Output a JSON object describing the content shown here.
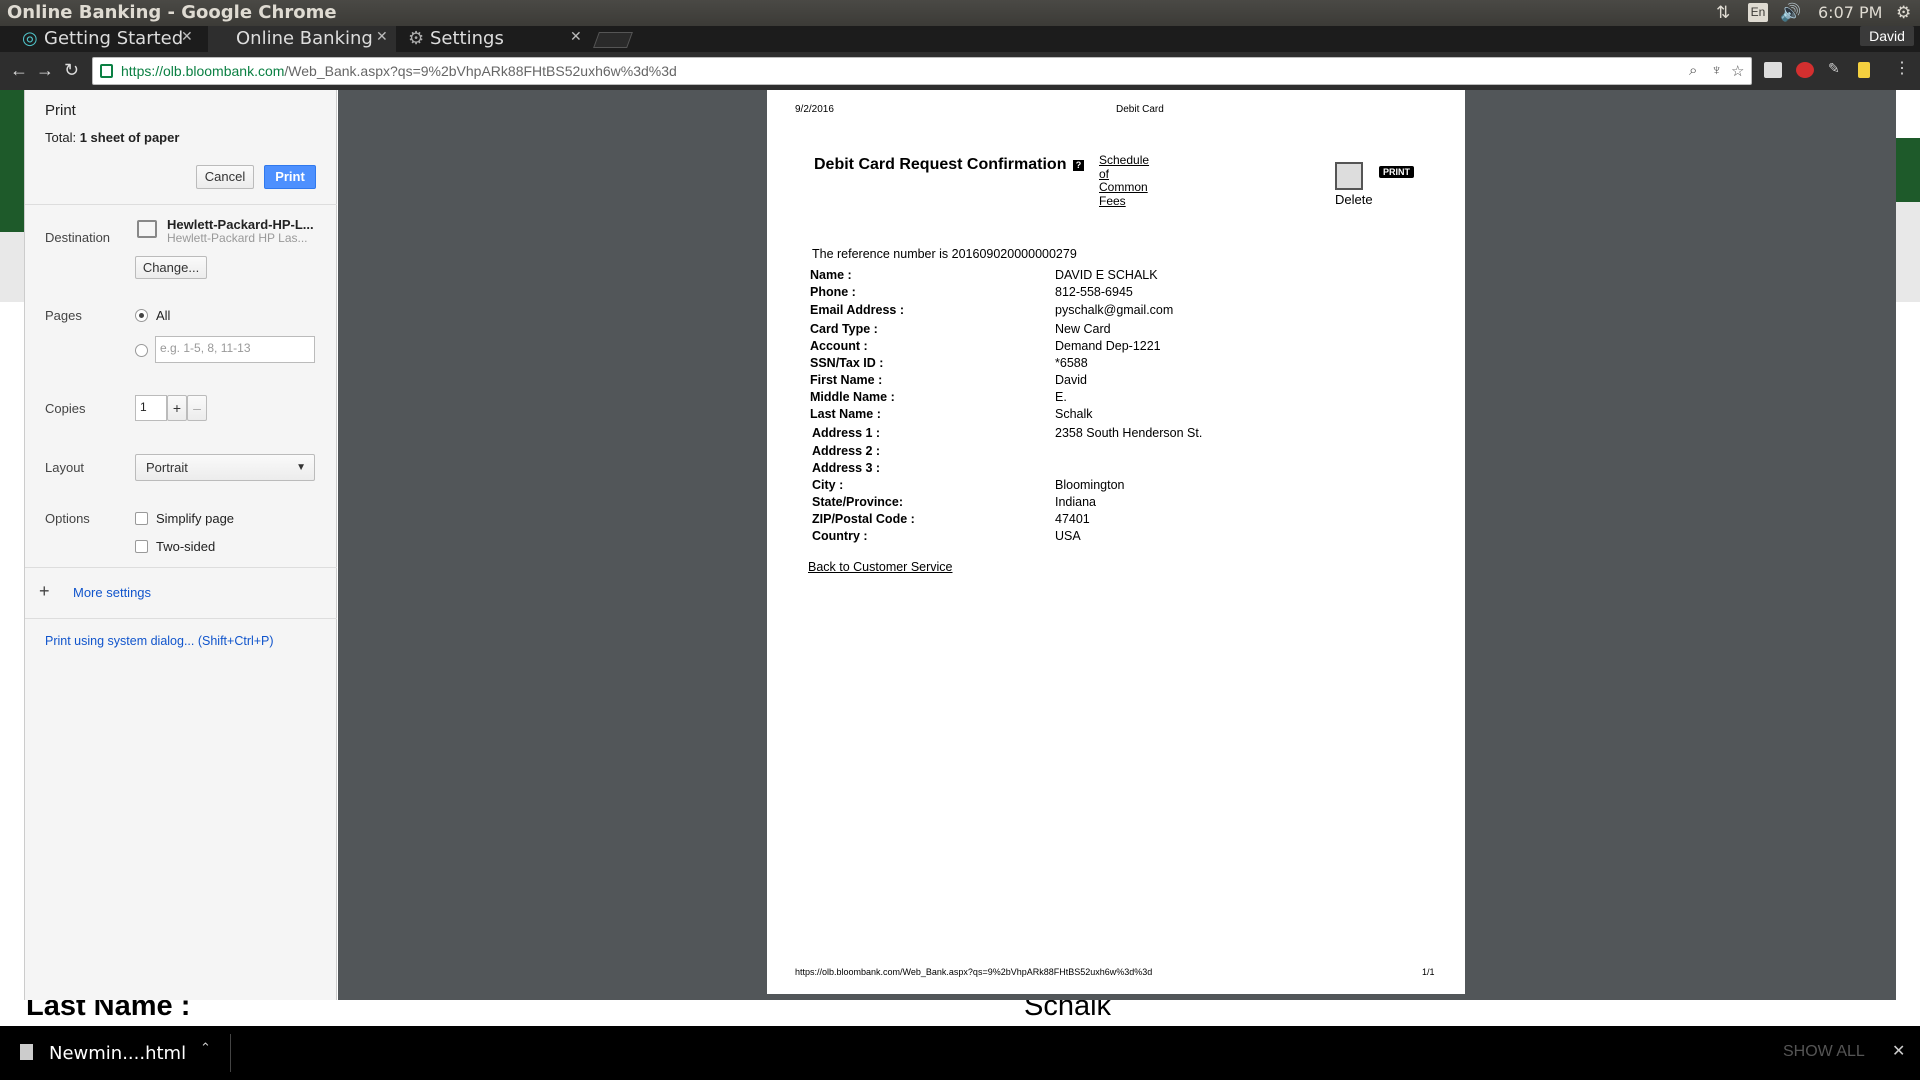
{
  "os": {
    "window_title": "Online Banking - Google Chrome",
    "lang": "En",
    "time": "6:07 PM"
  },
  "browser": {
    "tabs": [
      {
        "label": "Getting Started"
      },
      {
        "label": "Online Banking"
      },
      {
        "label": "Settings"
      }
    ],
    "profile": "David",
    "url_host": "https://olb.bloombank.com",
    "url_path": "/Web_Bank.aspx?qs=9%2bVhpARk88FHtBS52uxh6w%3d%3d"
  },
  "print_dialog": {
    "title": "Print",
    "total_label": "Total:",
    "total_value": "1 sheet of paper",
    "cancel_label": "Cancel",
    "print_label": "Print",
    "destination_label": "Destination",
    "destination_name": "Hewlett-Packard-HP-L...",
    "destination_sub": "Hewlett-Packard HP Las...",
    "change_label": "Change...",
    "pages_label": "Pages",
    "pages_all": "All",
    "pages_placeholder": "e.g. 1-5, 8, 11-13",
    "copies_label": "Copies",
    "copies_value": "1",
    "layout_label": "Layout",
    "layout_value": "Portrait",
    "options_label": "Options",
    "option_simplify": "Simplify page",
    "option_twosided": "Two-sided",
    "more_settings": "More settings",
    "system_dialog": "Print using system dialog... (Shift+Ctrl+P)"
  },
  "document": {
    "header_date": "9/2/2016",
    "header_title": "Debit Card",
    "heading": "Debit Card Request Confirmation",
    "help_glyph": "?",
    "schedule_link": [
      "Schedule",
      "of",
      "Common",
      "Fees"
    ],
    "print_badge": "PRINT",
    "delete_label": "Delete",
    "reference": "The reference number is 201609020000000279",
    "fields": [
      {
        "label": "Name :",
        "value": "DAVID E SCHALK"
      },
      {
        "label": "Phone :",
        "value": "812-558-6945"
      },
      {
        "label": "Email Address :",
        "value": "pyschalk@gmail.com"
      },
      {
        "label": "Card Type :",
        "value": "New Card"
      },
      {
        "label": "Account :",
        "value": "Demand Dep-1221"
      },
      {
        "label": "SSN/Tax ID :",
        "value": "*6588"
      },
      {
        "label": "First Name :",
        "value": "David"
      },
      {
        "label": "Middle Name :",
        "value": "E."
      },
      {
        "label": "Last Name :",
        "value": "Schalk"
      },
      {
        "label": "Address 1 :",
        "value": "2358 South Henderson St."
      },
      {
        "label": "Address 2 :",
        "value": ""
      },
      {
        "label": "Address 3 :",
        "value": ""
      },
      {
        "label": "City :",
        "value": "Bloomington"
      },
      {
        "label": "State/Province:",
        "value": "Indiana"
      },
      {
        "label": "ZIP/Postal Code :",
        "value": "47401"
      },
      {
        "label": "Country :",
        "value": "USA"
      }
    ],
    "back_link": "Back to Customer Service",
    "footer_url": "https://olb.bloombank.com/Web_Bank.aspx?qs=9%2bVhpARk88FHtBS52uxh6w%3d%3d",
    "footer_page": "1/1"
  },
  "page_behind": {
    "last_name_label": "Last Name :",
    "last_name_value": "Schalk"
  },
  "downloads": {
    "item_name": "Newmin....html",
    "show_all": "SHOW ALL"
  }
}
